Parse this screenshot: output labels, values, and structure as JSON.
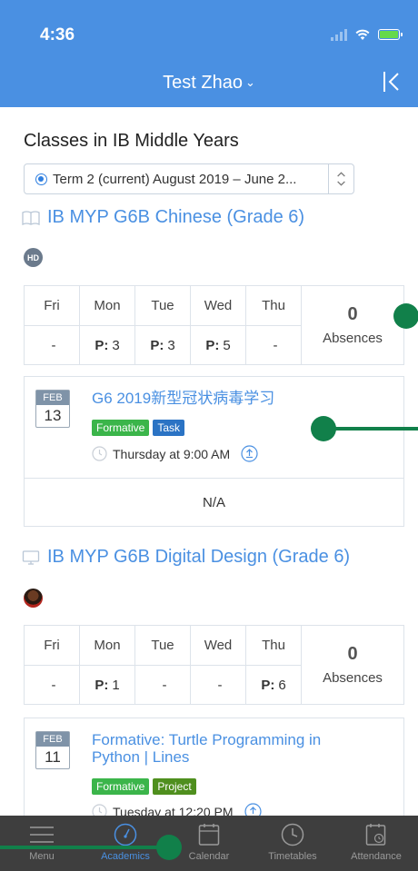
{
  "status": {
    "time": "4:36"
  },
  "header": {
    "title": "Test Zhao",
    "chevron": "⌄"
  },
  "section_title": "Classes in IB Middle Years",
  "term_select": {
    "value": "Term 2 (current) August 2019 – June 2..."
  },
  "classes": [
    {
      "title": "IB MYP G6B Chinese (Grade 6)",
      "icon": "book-icon",
      "teacher_initials": "HD",
      "days": [
        {
          "day": "Fri",
          "value": "-",
          "prefix": ""
        },
        {
          "day": "Mon",
          "value": "3",
          "prefix": "P:"
        },
        {
          "day": "Tue",
          "value": "3",
          "prefix": "P:"
        },
        {
          "day": "Wed",
          "value": "5",
          "prefix": "P:"
        },
        {
          "day": "Thu",
          "value": "-",
          "prefix": ""
        }
      ],
      "absences_count": "0",
      "absences_label": "Absences",
      "task": {
        "month": "FEB",
        "day": "13",
        "title": "G6 2019新型冠状病毒学习",
        "tags": [
          "Formative",
          "Task"
        ],
        "when": "Thursday at 9:00 AM",
        "grade": "N/A"
      }
    },
    {
      "title": "IB MYP G6B Digital Design (Grade 6)",
      "icon": "monitor-icon",
      "days": [
        {
          "day": "Fri",
          "value": "-",
          "prefix": ""
        },
        {
          "day": "Mon",
          "value": "1",
          "prefix": "P:"
        },
        {
          "day": "Tue",
          "value": "-",
          "prefix": ""
        },
        {
          "day": "Wed",
          "value": "-",
          "prefix": ""
        },
        {
          "day": "Thu",
          "value": "6",
          "prefix": "P:"
        }
      ],
      "absences_count": "0",
      "absences_label": "Absences",
      "task": {
        "month": "FEB",
        "day": "11",
        "title": "Formative: Turtle Programming in Python | Lines",
        "tags": [
          "Formative",
          "Project"
        ],
        "when": "Tuesday at 12:20 PM"
      }
    }
  ],
  "tabbar": [
    {
      "label": "Menu",
      "icon": "menu-icon",
      "active": false
    },
    {
      "label": "Academics",
      "icon": "gauge-icon",
      "active": true
    },
    {
      "label": "Calendar",
      "icon": "calendar-icon",
      "active": false
    },
    {
      "label": "Timetables",
      "icon": "clock-icon",
      "active": false
    },
    {
      "label": "Attendance",
      "icon": "attendance-icon",
      "active": false
    }
  ],
  "colors": {
    "header": "#4a90e2",
    "link": "#4a90e2",
    "tabbar": "#3e3e3e",
    "marker": "#11804a"
  }
}
